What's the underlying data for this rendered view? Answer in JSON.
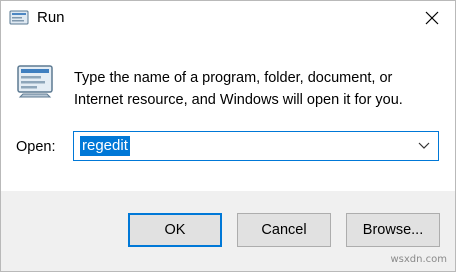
{
  "window": {
    "title": "Run",
    "close_icon": "close-icon"
  },
  "body": {
    "description_line1": "Type the name of a program, folder, document, or",
    "description_line2": "Internet resource, and Windows will open it for you.",
    "icon": "run-app-icon"
  },
  "open_field": {
    "label": "Open:",
    "value": "regedit",
    "dropdown_icon": "chevron-down-icon"
  },
  "buttons": {
    "ok": "OK",
    "cancel": "Cancel",
    "browse": "Browse..."
  },
  "watermark": "wsxdn.com",
  "colors": {
    "accent": "#0078d7",
    "footer_bg": "#f0f0f0",
    "button_bg": "#e1e1e1"
  }
}
